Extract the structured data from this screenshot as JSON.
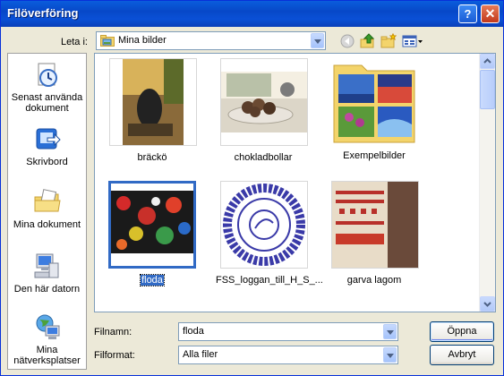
{
  "window": {
    "title": "Filöverföring",
    "help_label": "?",
    "close_label": "✕"
  },
  "look_in": {
    "label": "Leta i:",
    "value": "Mina bilder"
  },
  "toolbar": {
    "icons": [
      "back-icon",
      "up-folder-icon",
      "new-folder-icon",
      "view-menu-icon"
    ]
  },
  "places": [
    {
      "label": "Senast använda dokument"
    },
    {
      "label": "Skrivbord"
    },
    {
      "label": "Mina dokument"
    },
    {
      "label": "Den här datorn"
    },
    {
      "label": "Mina nätverksplatser"
    }
  ],
  "files": [
    {
      "name": "bräckö"
    },
    {
      "name": "chokladbollar"
    },
    {
      "name": "Exempelbilder"
    },
    {
      "name": "floda"
    },
    {
      "name": "FSS_loggan_till_H_S_..."
    },
    {
      "name": "garva lagom"
    }
  ],
  "filename": {
    "label": "Filnamn:",
    "value": "floda"
  },
  "filetype": {
    "label": "Filformat:",
    "value": "Alla filer"
  },
  "buttons": {
    "open": "Öppna",
    "cancel": "Avbryt"
  },
  "colors": {
    "title_bar": "#0a5ddc",
    "selection": "#316ac5",
    "dialog_bg": "#ece9d8"
  }
}
